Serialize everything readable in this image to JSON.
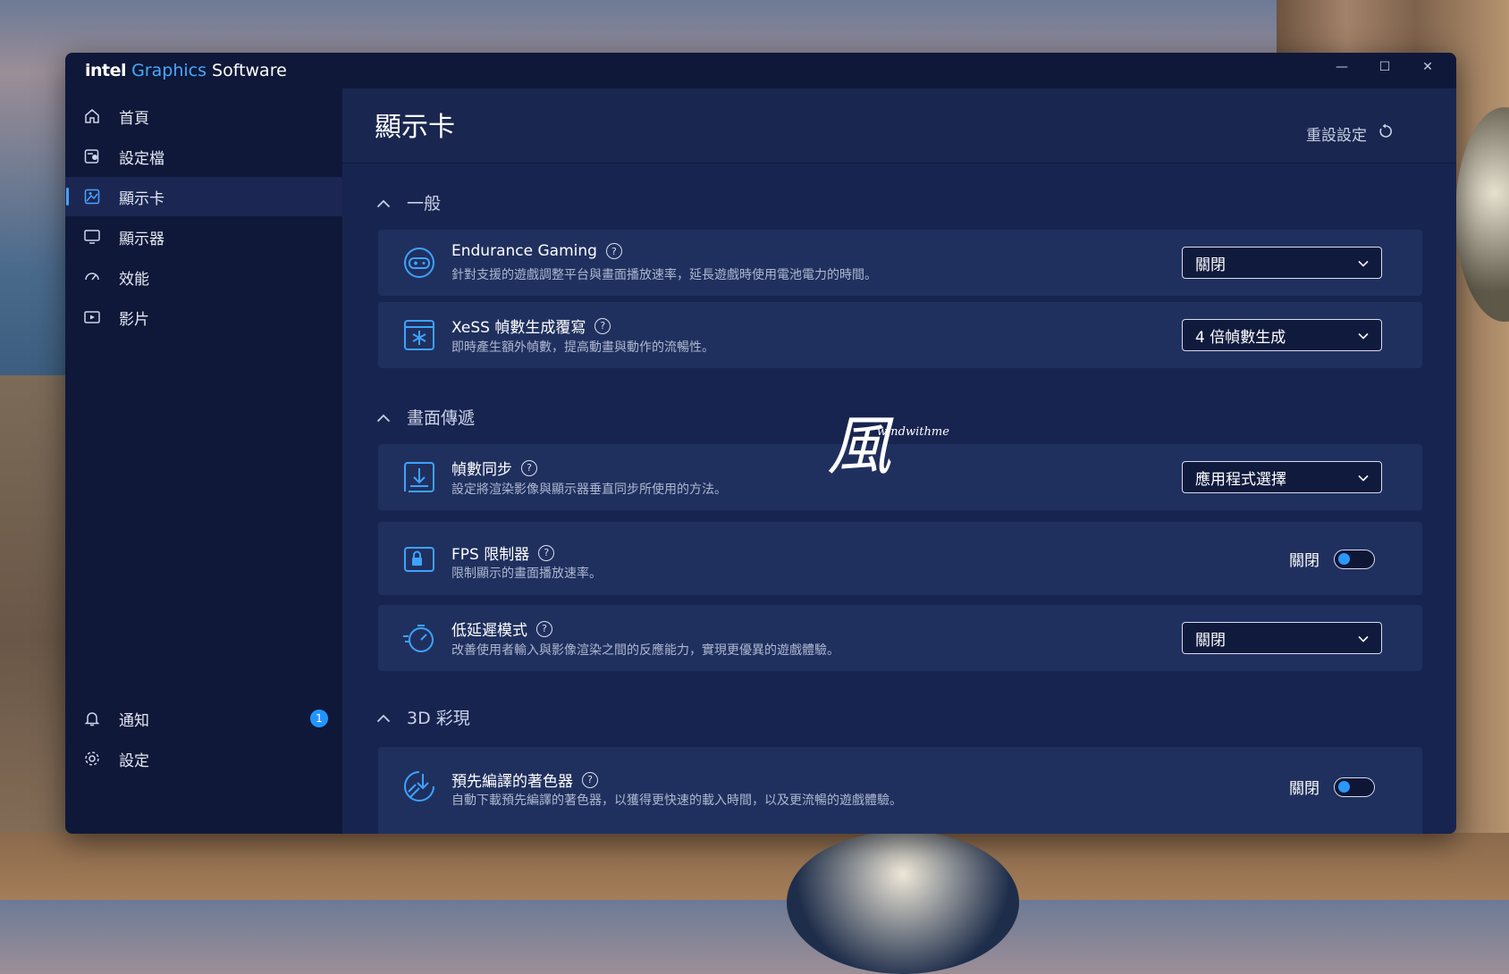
{
  "app": {
    "brand_intel": "intel",
    "brand_graphics": "Graphics",
    "brand_software": "Software"
  },
  "window_controls": {
    "minimize": "—",
    "maximize": "☐",
    "close": "✕"
  },
  "sidebar": {
    "items": [
      {
        "label": "首頁",
        "icon": "home-icon"
      },
      {
        "label": "設定檔",
        "icon": "profile-icon"
      },
      {
        "label": "顯示卡",
        "icon": "graphics-card-icon",
        "active": true
      },
      {
        "label": "顯示器",
        "icon": "monitor-icon"
      },
      {
        "label": "效能",
        "icon": "performance-icon"
      },
      {
        "label": "影片",
        "icon": "video-icon"
      }
    ],
    "bottom": [
      {
        "label": "通知",
        "icon": "bell-icon",
        "badge": "1"
      },
      {
        "label": "設定",
        "icon": "gear-icon"
      }
    ]
  },
  "header": {
    "title": "顯示卡",
    "reset_label": "重設設定"
  },
  "sections": {
    "general": {
      "title": "一般",
      "endurance": {
        "title": "Endurance Gaming",
        "desc": "針對支援的遊戲調整平台與畫面播放速率，延長遊戲時使用電池電力的時間。",
        "value": "關閉"
      },
      "xess": {
        "title": "XeSS 幀數生成覆寫",
        "desc": "即時產生額外幀數，提高動畫與動作的流暢性。",
        "value": "4 倍幀數生成"
      }
    },
    "display": {
      "title": "畫面傳遞",
      "vsync": {
        "title": "幀數同步",
        "desc": "設定將渲染影像與顯示器垂直同步所使用的方法。",
        "value": "應用程式選擇"
      },
      "fps": {
        "title": "FPS 限制器",
        "desc": "限制顯示的畫面播放速率。",
        "toggle_label": "關閉"
      },
      "latency": {
        "title": "低延遲模式",
        "desc": "改善使用者輸入與影像渲染之間的反應能力，實現更優異的遊戲體驗。",
        "value": "關閉"
      }
    },
    "color3d": {
      "title": "3D 彩現",
      "shader": {
        "title": "預先編譯的著色器",
        "desc": "自動下載預先編譯的著色器，以獲得更快速的載入時間，以及更流暢的遊戲體驗。",
        "toggle_label": "關閉"
      }
    }
  },
  "watermark": {
    "glyph": "風",
    "text": "windwithme"
  },
  "colors": {
    "accent": "#2b98ff",
    "window_bg": "#0f1838",
    "panel_bg": "#182450",
    "card_bg": "#20305e"
  }
}
